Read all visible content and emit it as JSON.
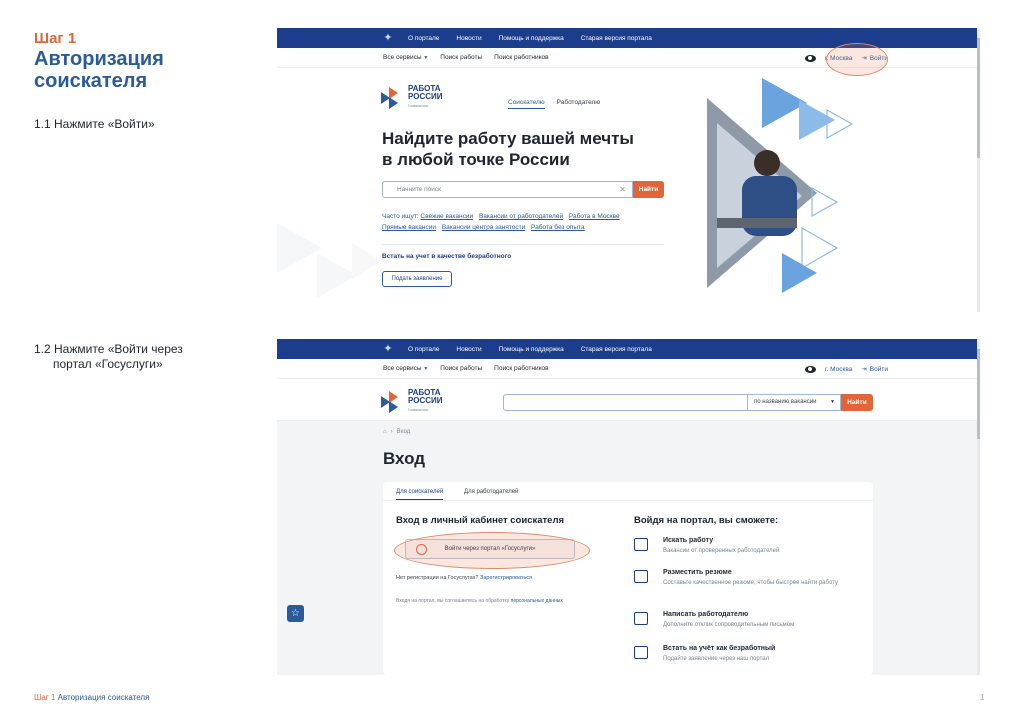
{
  "doc": {
    "step_label": "Шаг 1",
    "heading": "Авторизация соискателя",
    "instruction_1": "1.1 Нажмите «Войти»",
    "instruction_2_line1": "1.2 Нажмите «Войти через",
    "instruction_2_line2": "портал «Госуслуги»",
    "footer_step": "Шаг 1",
    "footer_title": "Авторизация соискателя",
    "page_number": "1"
  },
  "portal": {
    "topbar": [
      "О портале",
      "Новости",
      "Помощь и поддержка",
      "Старая версия портала"
    ],
    "subbar": {
      "services": "Все сервисы",
      "find_job": "Поиск работы",
      "find_workers": "Поиск работников",
      "city": "г. Москва",
      "login": "Войти"
    },
    "logo": {
      "line1": "РАБОТА",
      "line2": "РОССИИ",
      "sub": "Госвакансии"
    },
    "search_button": "Найти"
  },
  "screen1": {
    "tab_seeker": "Соискателю",
    "tab_employer": "Работодателю",
    "hero_line1": "Найдите работу вашей мечты",
    "hero_line2": "в любой точке России",
    "search_placeholder": "Начните поиск",
    "often_label": "Часто ищут:",
    "often_links": [
      "Свежие вакансии",
      "Вакансии от работодателей",
      "Работа в Москве",
      "Прямые вакансии",
      "Вакансии центра занятости",
      "Работа без опыта"
    ],
    "unemployed_link": "Встать на учет в качестве безработного",
    "apply_button": "Подать заявление"
  },
  "screen2": {
    "search_select": "по названию вакансии",
    "breadcrumb": "Вход",
    "title": "Вход",
    "tab_seekers": "Для соискателей",
    "tab_employers": "Для работодателей",
    "left_heading": "Вход в личный кабинет соискателя",
    "gosuslugi_button": "Войти через портал «Госуслуги»",
    "no_reg": "Нет регистрации на Госуслугах?",
    "register_link": "Зарегистрироваться",
    "agree_text": "Входя на портал, вы соглашаетесь на обработку",
    "agree_link": "персональных данных",
    "right_heading": "Войдя на портал, вы сможете:",
    "features": [
      {
        "title": "Искать работу",
        "desc": "Вакансии от проверенных работодателей"
      },
      {
        "title": "Разместить резюме",
        "desc": "Составьте качественное резюме, чтобы быстрее найти работу"
      },
      {
        "title": "Написать работодателю",
        "desc": "Дополните отклик сопроводительным письмом"
      },
      {
        "title": "Встать на учёт как безработный",
        "desc": "Подайте заявление через наш портал"
      }
    ]
  },
  "colors": {
    "brand_blue": "#1c3d8c",
    "accent_orange": "#e2653a",
    "heading_blue": "#2a5b9b"
  }
}
